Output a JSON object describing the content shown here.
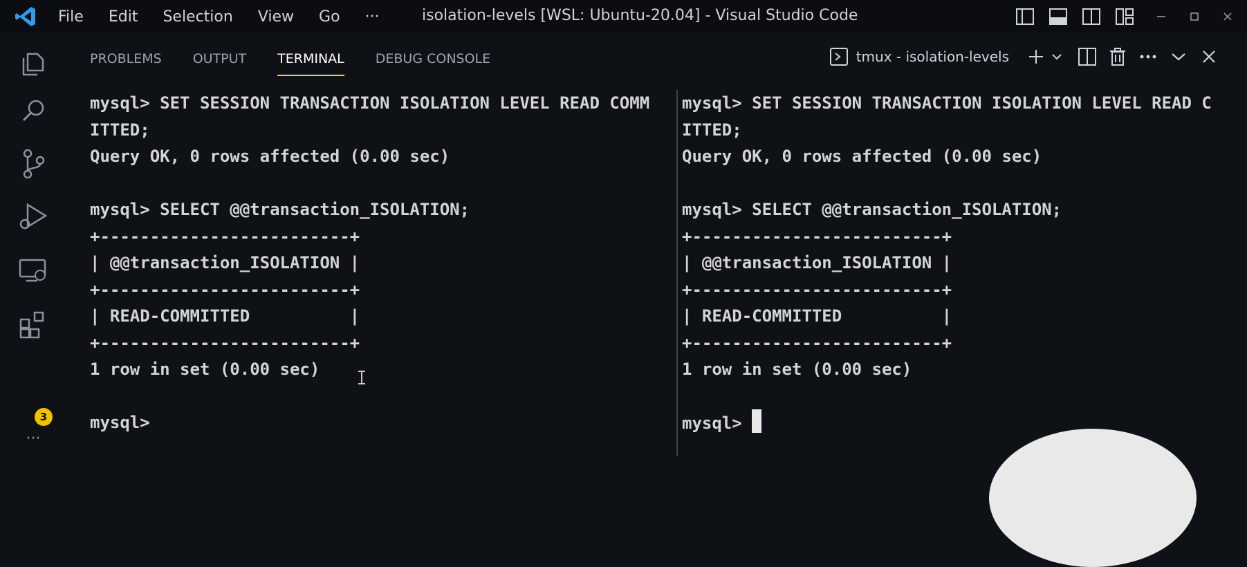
{
  "app": {
    "window_title": "isolation-levels [WSL: Ubuntu-20.04] - Visual Studio Code",
    "menu": [
      "File",
      "Edit",
      "Selection",
      "View",
      "Go",
      "···"
    ]
  },
  "activity_bar": {
    "items": [
      "explorer-icon",
      "search-icon",
      "source-control-icon",
      "run-debug-icon",
      "remote-explorer-icon",
      "extensions-icon",
      "more-icon"
    ],
    "extensions_badge": "3",
    "more_label": "···"
  },
  "panel": {
    "tabs": [
      "PROBLEMS",
      "OUTPUT",
      "TERMINAL",
      "DEBUG CONSOLE"
    ],
    "active_tab": "TERMINAL",
    "terminal_name": "tmux - isolation-levels",
    "accent_color": "#e7d43b"
  },
  "terminal_left": {
    "lines": [
      "mysql> SET SESSION TRANSACTION ISOLATION LEVEL READ COMM",
      "ITTED;",
      "Query OK, 0 rows affected (0.00 sec)",
      "",
      "mysql> SELECT @@transaction_ISOLATION;",
      "+-------------------------+",
      "| @@transaction_ISOLATION |",
      "+-------------------------+",
      "| READ-COMMITTED          |",
      "+-------------------------+",
      "1 row in set (0.00 sec)",
      "",
      "mysql> "
    ]
  },
  "terminal_right": {
    "lines": [
      "mysql> SET SESSION TRANSACTION ISOLATION LEVEL READ C",
      "ITTED;",
      "Query OK, 0 rows affected (0.00 sec)",
      "",
      "mysql> SELECT @@transaction_ISOLATION;",
      "+-------------------------+",
      "| @@transaction_ISOLATION |",
      "+-------------------------+",
      "| READ-COMMITTED          |",
      "+-------------------------+",
      "1 row in set (0.00 sec)",
      "",
      "mysql> "
    ]
  }
}
